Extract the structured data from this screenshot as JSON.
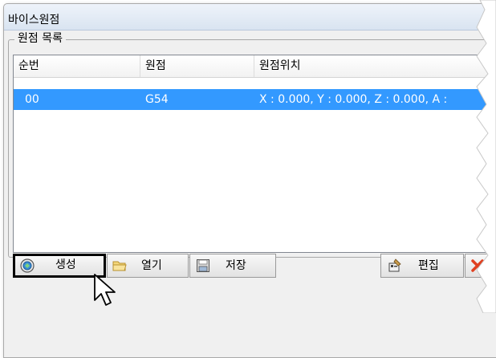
{
  "window": {
    "title": "바이스원점"
  },
  "group": {
    "label": "원점 목록"
  },
  "table": {
    "headers": [
      "순번",
      "원점",
      "원점위치"
    ],
    "rows": [
      {
        "index": "00",
        "origin": "G54",
        "position": "X : 0.000, Y : 0.000, Z : 0.000, A :",
        "selected": true
      }
    ]
  },
  "buttons": {
    "create": "생성",
    "open": "열기",
    "save": "저장",
    "edit": "편집"
  },
  "colors": {
    "selection": "#3399ff",
    "highlight_border": "#000000",
    "delete_icon": "#e04020"
  }
}
